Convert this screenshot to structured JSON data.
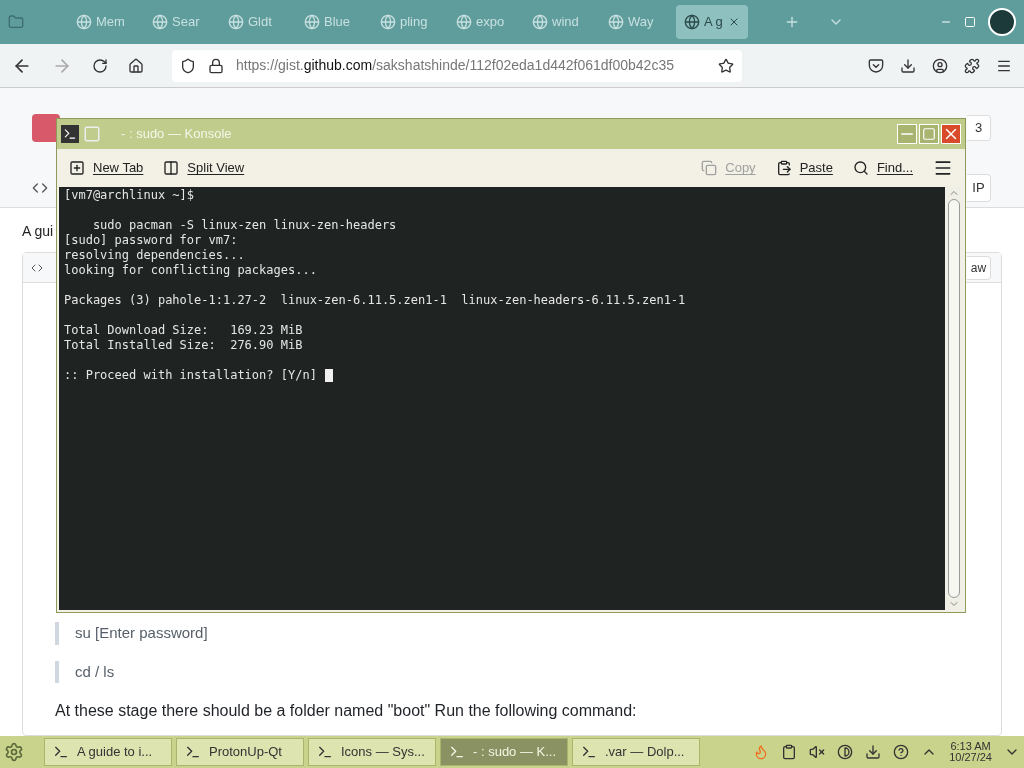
{
  "browser": {
    "tabs": [
      {
        "label": "Mem",
        "selected": false
      },
      {
        "label": "Sear",
        "selected": false
      },
      {
        "label": "Gldt",
        "selected": false
      },
      {
        "label": "Blue",
        "selected": false
      },
      {
        "label": "pling",
        "selected": false
      },
      {
        "label": "expo",
        "selected": false
      },
      {
        "label": "wind",
        "selected": false
      },
      {
        "label": "Way",
        "selected": false
      },
      {
        "label": "A g",
        "selected": true
      }
    ],
    "url": {
      "prefix": "https://gist.",
      "domain": "github.com",
      "path": "/sakshatshinde/112f02eda1d442f061df00b42c35"
    }
  },
  "page": {
    "header_button": "3",
    "code_button": "IP",
    "intro": "A gui",
    "raw_button": "aw",
    "quotes": [
      "su [Enter password]",
      "cd / ls"
    ],
    "paragraph": "At these stage there should be a folder named \"boot\" Run the following command:"
  },
  "konsole": {
    "title": "- : sudo — Konsole",
    "toolbar": [
      {
        "label": "New Tab",
        "disabled": false
      },
      {
        "label": "Split View",
        "disabled": false
      },
      {
        "label": "Copy",
        "disabled": true
      },
      {
        "label": "Paste",
        "disabled": false
      },
      {
        "label": "Find...",
        "disabled": false
      }
    ],
    "blocks": [
      [
        "[vm7@archlinux ~]$"
      ],
      [
        "    sudo pacman -S linux-zen linux-zen-headers",
        "[sudo] password for vm7:",
        "resolving dependencies...",
        "looking for conflicting packages..."
      ],
      [
        "Packages (3) pahole-1:1.27-2  linux-zen-6.11.5.zen1-1  linux-zen-headers-6.11.5.zen1-1"
      ],
      [
        "Total Download Size:   169.23 MiB",
        "Total Installed Size:  276.90 MiB"
      ],
      [
        ":: Proceed with installation? [Y/n]"
      ]
    ]
  },
  "taskbar": {
    "tasks": [
      {
        "label": "A guide to i...",
        "selected": false
      },
      {
        "label": "ProtonUp-Qt",
        "selected": false
      },
      {
        "label": "Icons — Sys...",
        "selected": false
      },
      {
        "label": "- : sudo — K...",
        "selected": true
      },
      {
        "label": ".var — Dolp...",
        "selected": false
      }
    ],
    "time": "6:13 AM",
    "date": "10/27/24"
  }
}
